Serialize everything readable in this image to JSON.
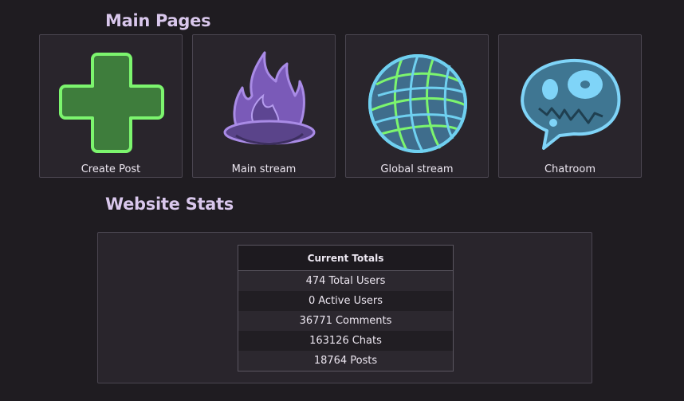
{
  "sections": {
    "main_pages": "Main Pages",
    "website_stats": "Website Stats"
  },
  "tiles": [
    {
      "label": "Create Post",
      "icon": "green-plus-icon",
      "color": "#7cf56e"
    },
    {
      "label": "Main stream",
      "icon": "purple-flame-icon",
      "color": "#a98be6"
    },
    {
      "label": "Global stream",
      "icon": "globe-icon",
      "color": "#6fd0f0"
    },
    {
      "label": "Chatroom",
      "icon": "skull-speech-bubble-icon",
      "color": "#7fd4f8"
    }
  ],
  "stats": {
    "header": "Current Totals",
    "rows": [
      {
        "value": "474",
        "label": "Total Users"
      },
      {
        "value": "0",
        "label": "Active Users"
      },
      {
        "value": "36771",
        "label": "Comments"
      },
      {
        "value": "163126",
        "label": "Chats"
      },
      {
        "value": "18764",
        "label": "Posts"
      }
    ]
  }
}
